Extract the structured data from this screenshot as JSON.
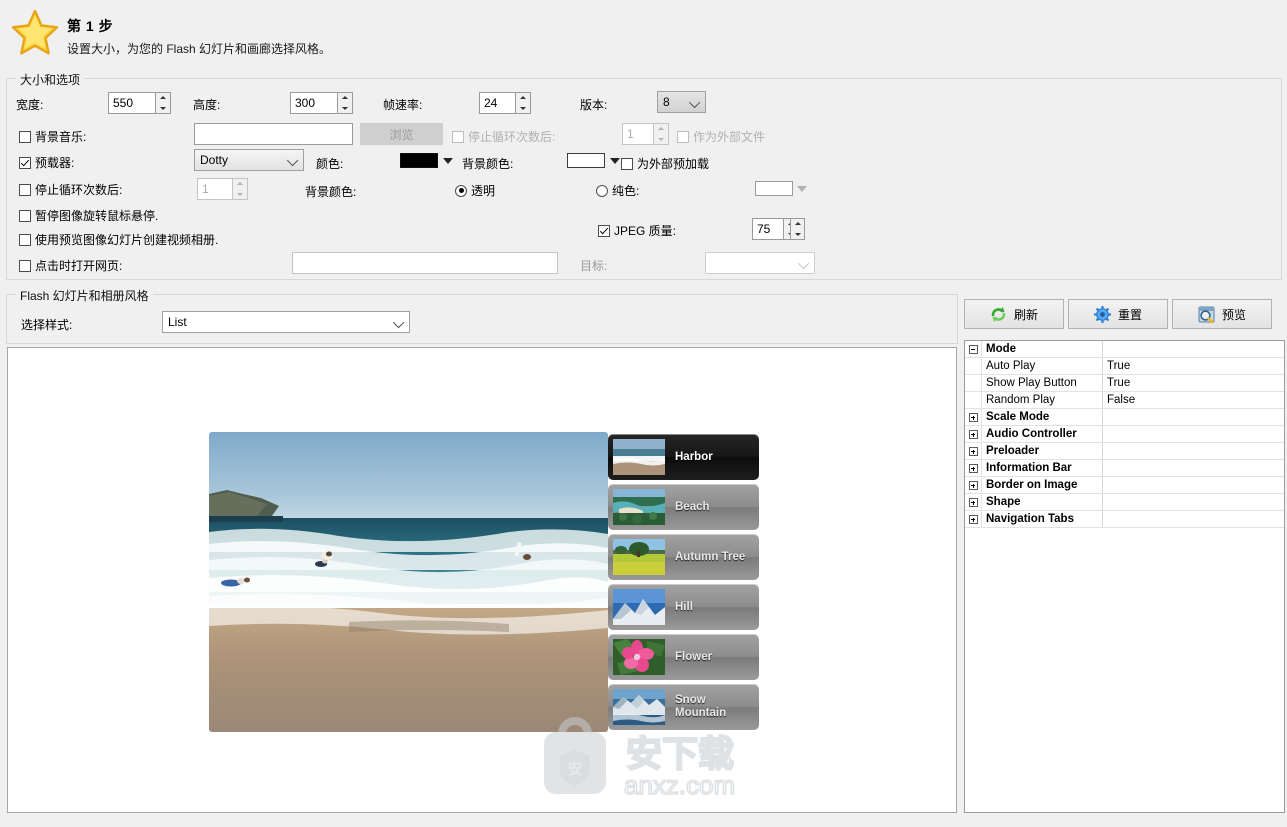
{
  "header": {
    "title": "第 1 步",
    "subtitle": "设置大小，为您的 Flash 幻灯片和画廊选择风格。",
    "icon": "star-icon"
  },
  "size_group": {
    "legend": "大小和选项",
    "width_label": "宽度:",
    "width_value": "550",
    "height_label": "高度:",
    "height_value": "300",
    "framerate_label": "帧速率:",
    "framerate_value": "24",
    "version_label": "版本:",
    "version_value": "8",
    "bgmusic_label": "背景音乐:",
    "bgmusic_checked": false,
    "bgmusic_path": "",
    "browse_label": "浏览",
    "stop_after_loops_label": "停止循环次数后:",
    "stop_after_loops_value": "1",
    "as_external_file_label": "作为外部文件",
    "preloader_label": "预载器:",
    "preloader_checked": true,
    "preloader_value": "Dotty",
    "color_label": "颜色:",
    "color_value": "#000000",
    "bgcolor_label": "背景颜色:",
    "bgcolor_value": "#ffffff",
    "preload_external_label": "为外部预加载",
    "stop_loops_label2": "停止循环次数后:",
    "stop_loops_value2": "1",
    "bgcolor_label2": "背景颜色:",
    "transparent_label": "透明",
    "solid_label": "纯色:",
    "solid_color_value": "#ffffff",
    "pause_on_hover_label": "暂停图像旋转鼠标悬停.",
    "jpeg_quality_label": "JPEG 质量:",
    "jpeg_quality_value": "75",
    "jpeg_checked": true,
    "video_album_label": "使用预览图像幻灯片创建视频相册.",
    "open_web_label": "点击时打开网页:",
    "open_web_value": "",
    "target_label": "目标:",
    "target_value": ""
  },
  "style_group": {
    "legend": "Flash 幻灯片和相册风格",
    "select_style_label": "选择样式:",
    "style_value": "List"
  },
  "toolbar": {
    "refresh_label": "刷新",
    "reset_label": "重置",
    "preview_label": "预览"
  },
  "stage": {
    "watermark_text": "anxz.com",
    "watermark_cn": "安下载",
    "items": [
      {
        "caption": "Harbor",
        "active": true
      },
      {
        "caption": "Beach",
        "active": false
      },
      {
        "caption": "Autumn Tree",
        "active": false
      },
      {
        "caption": "Hill",
        "active": false
      },
      {
        "caption": "Flower",
        "active": false
      },
      {
        "caption": "Snow Mountain",
        "active": false
      }
    ]
  },
  "properties": {
    "rows": [
      {
        "expander": "minus",
        "name": "Mode",
        "value": "",
        "group": true
      },
      {
        "expander": "none",
        "name": "Auto Play",
        "value": "True",
        "group": false
      },
      {
        "expander": "none",
        "name": "Show Play Button",
        "value": "True",
        "group": false
      },
      {
        "expander": "none",
        "name": "Random Play",
        "value": "False",
        "group": false
      },
      {
        "expander": "plus",
        "name": "Scale Mode",
        "value": "",
        "group": true
      },
      {
        "expander": "plus",
        "name": "Audio Controller",
        "value": "",
        "group": true
      },
      {
        "expander": "plus",
        "name": "Preloader",
        "value": "",
        "group": true
      },
      {
        "expander": "plus",
        "name": "Information Bar",
        "value": "",
        "group": true
      },
      {
        "expander": "plus",
        "name": "Border on Image",
        "value": "",
        "group": true
      },
      {
        "expander": "plus",
        "name": "Shape",
        "value": "",
        "group": true
      },
      {
        "expander": "plus",
        "name": "Navigation Tabs",
        "value": "",
        "group": true
      }
    ]
  }
}
